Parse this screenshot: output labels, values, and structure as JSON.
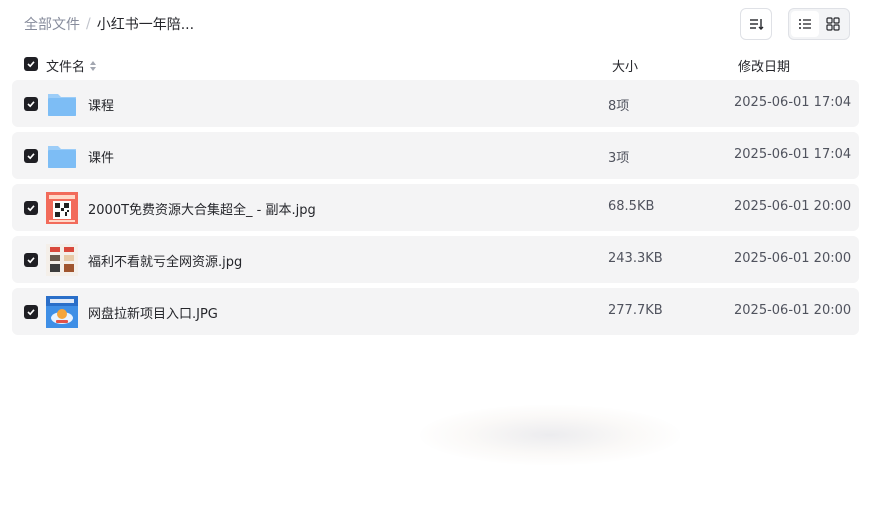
{
  "breadcrumb": {
    "root": "全部文件",
    "separator": "/",
    "current": "小红书一年陪..."
  },
  "toolbar": {
    "sort_icon": "sort-list-icon",
    "view_list_icon": "list-view-icon",
    "view_grid_icon": "grid-view-icon",
    "active_view": "list"
  },
  "columns": {
    "name": "文件名",
    "size": "大小",
    "date": "修改日期"
  },
  "files": [
    {
      "name": "课程",
      "size": "8项",
      "date": "2025-06-01 17:04",
      "type": "folder",
      "checked": true
    },
    {
      "name": "课件",
      "size": "3项",
      "date": "2025-06-01 17:04",
      "type": "folder",
      "checked": true
    },
    {
      "name": "2000T免费资源大合集超全_ - 副本.jpg",
      "size": "68.5KB",
      "date": "2025-06-01 20:00",
      "type": "image",
      "checked": true
    },
    {
      "name": "福利不看就亏全网资源.jpg",
      "size": "243.3KB",
      "date": "2025-06-01 20:00",
      "type": "image",
      "checked": true
    },
    {
      "name": "网盘拉新项目入口.JPG",
      "size": "277.7KB",
      "date": "2025-06-01 20:00",
      "type": "image",
      "checked": true
    }
  ],
  "colors": {
    "folder": "#7dbdf5",
    "checkbox": "#1f1f24",
    "row_bg": "#f4f4f5"
  }
}
